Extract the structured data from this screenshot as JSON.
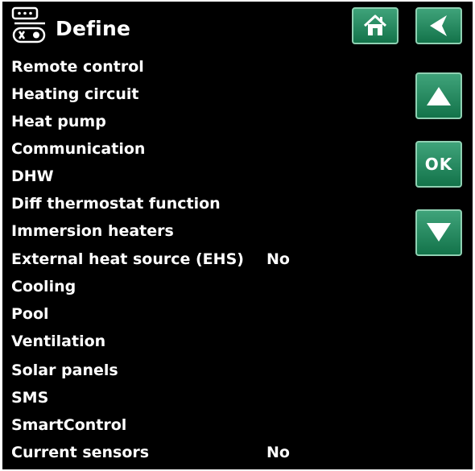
{
  "header": {
    "title": "Define",
    "icon": "controller-settings-icon"
  },
  "nav": {
    "home_icon": "home-icon",
    "back_icon": "back-arrow-icon",
    "up_icon": "arrow-up-icon",
    "down_icon": "arrow-down-icon",
    "ok_label": "OK",
    "button_color": "#2e8c62"
  },
  "menu": {
    "items": [
      {
        "label": "Remote control",
        "value": ""
      },
      {
        "label": "Heating circuit",
        "value": ""
      },
      {
        "label": "Heat pump",
        "value": ""
      },
      {
        "label": "Communication",
        "value": ""
      },
      {
        "label": "DHW",
        "value": ""
      },
      {
        "label": "Diff thermostat function",
        "value": ""
      },
      {
        "label": "Immersion heaters",
        "value": ""
      },
      {
        "label": "External heat source (EHS)",
        "value": "No"
      },
      {
        "label": "Cooling",
        "value": ""
      },
      {
        "label": "Pool",
        "value": ""
      },
      {
        "label": "Ventilation",
        "value": ""
      },
      {
        "label": "Solar panels",
        "value": ""
      },
      {
        "label": "SMS",
        "value": ""
      },
      {
        "label": "SmartControl",
        "value": ""
      },
      {
        "label": "Current sensors",
        "value": "No"
      }
    ]
  }
}
